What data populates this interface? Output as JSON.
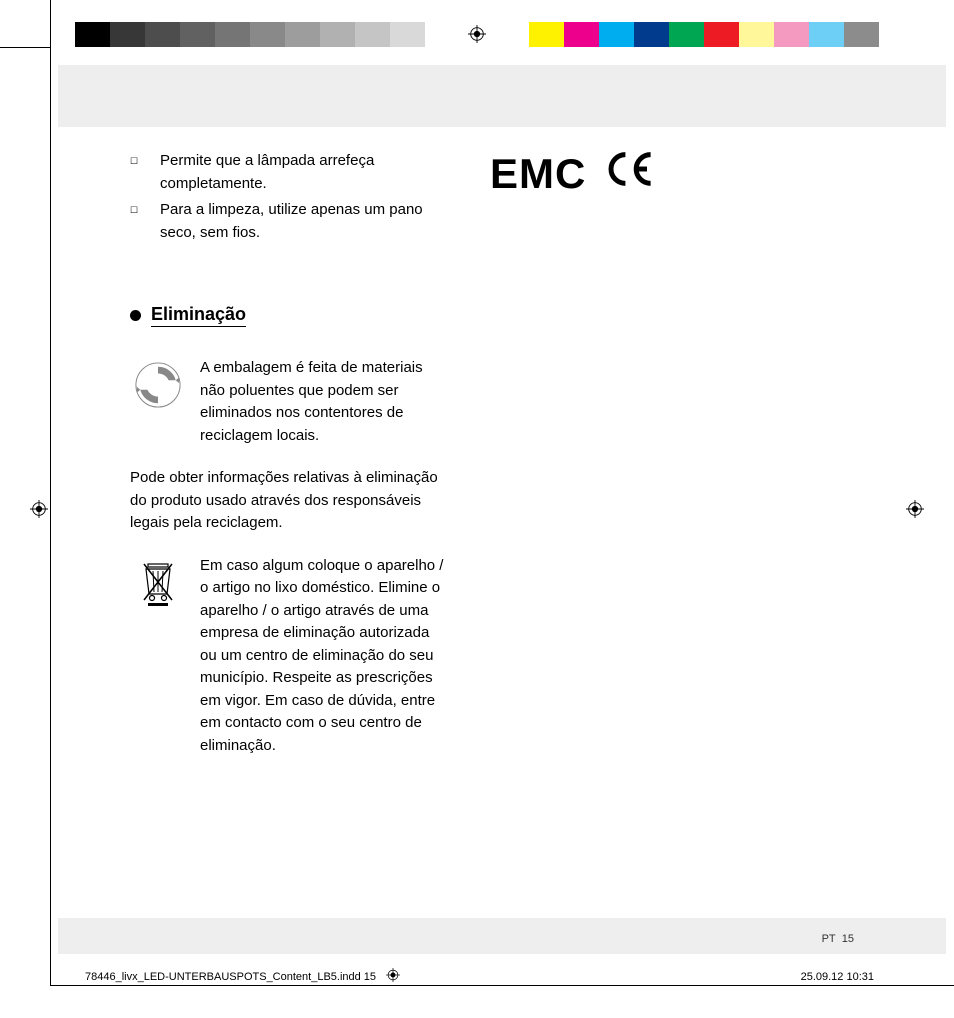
{
  "color_bar": [
    "#000000",
    "#373737",
    "#4d4d4d",
    "#616161",
    "#757575",
    "#898989",
    "#9d9d9d",
    "#b1b1b1",
    "#c5c5c5",
    "#d9d9d9",
    "#ffffff",
    "transparent",
    "transparent",
    "#fff200",
    "#ec008c",
    "#00aeef",
    "#003b8e",
    "#00a651",
    "#ed1c24",
    "#fff799",
    "#f49ac1",
    "#6dcff6",
    "#8c8c8c"
  ],
  "bullets": [
    "Permite que a lâmpada arrefeça completamente.",
    "Para a limpeza, utilize apenas um pano seco, sem fios."
  ],
  "heading": "Eliminação",
  "icon_para_1": "A embalagem é feita de materiais não poluentes que podem ser eliminados nos contentores de reciclagem locais.",
  "mid_para": "Pode obter informações relativas à eliminação do produto usado através dos responsáveis legais pela reciclagem.",
  "icon_para_2": "Em caso algum coloque o aparelho / o artigo no lixo doméstico. Elimine o aparelho / o artigo através de uma empresa de eliminação autorizada ou um centro de eliminação do seu município. Respeite as prescrições em vigor. Em caso de dúvida, entre em contacto com o seu centro de eliminação.",
  "emc_label": "EMC",
  "page_lang": "PT",
  "page_number": "15",
  "footer_file": "78446_livx_LED-UNTERBAUSPOTS_Content_LB5.indd   15",
  "footer_timestamp": "25.09.12   10:31"
}
